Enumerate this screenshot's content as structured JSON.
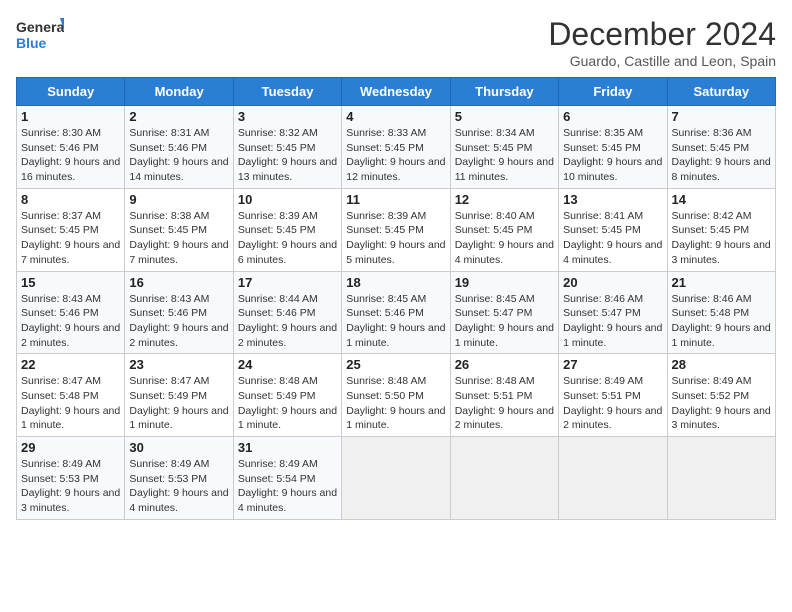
{
  "logo": {
    "line1": "General",
    "line2": "Blue"
  },
  "title": "December 2024",
  "location": "Guardo, Castille and Leon, Spain",
  "days_of_week": [
    "Sunday",
    "Monday",
    "Tuesday",
    "Wednesday",
    "Thursday",
    "Friday",
    "Saturday"
  ],
  "weeks": [
    [
      {
        "day": "1",
        "sunrise": "8:30 AM",
        "sunset": "5:46 PM",
        "daylight": "9 hours and 16 minutes."
      },
      {
        "day": "2",
        "sunrise": "8:31 AM",
        "sunset": "5:46 PM",
        "daylight": "9 hours and 14 minutes."
      },
      {
        "day": "3",
        "sunrise": "8:32 AM",
        "sunset": "5:45 PM",
        "daylight": "9 hours and 13 minutes."
      },
      {
        "day": "4",
        "sunrise": "8:33 AM",
        "sunset": "5:45 PM",
        "daylight": "9 hours and 12 minutes."
      },
      {
        "day": "5",
        "sunrise": "8:34 AM",
        "sunset": "5:45 PM",
        "daylight": "9 hours and 11 minutes."
      },
      {
        "day": "6",
        "sunrise": "8:35 AM",
        "sunset": "5:45 PM",
        "daylight": "9 hours and 10 minutes."
      },
      {
        "day": "7",
        "sunrise": "8:36 AM",
        "sunset": "5:45 PM",
        "daylight": "9 hours and 8 minutes."
      }
    ],
    [
      {
        "day": "8",
        "sunrise": "8:37 AM",
        "sunset": "5:45 PM",
        "daylight": "9 hours and 7 minutes."
      },
      {
        "day": "9",
        "sunrise": "8:38 AM",
        "sunset": "5:45 PM",
        "daylight": "9 hours and 7 minutes."
      },
      {
        "day": "10",
        "sunrise": "8:39 AM",
        "sunset": "5:45 PM",
        "daylight": "9 hours and 6 minutes."
      },
      {
        "day": "11",
        "sunrise": "8:39 AM",
        "sunset": "5:45 PM",
        "daylight": "9 hours and 5 minutes."
      },
      {
        "day": "12",
        "sunrise": "8:40 AM",
        "sunset": "5:45 PM",
        "daylight": "9 hours and 4 minutes."
      },
      {
        "day": "13",
        "sunrise": "8:41 AM",
        "sunset": "5:45 PM",
        "daylight": "9 hours and 4 minutes."
      },
      {
        "day": "14",
        "sunrise": "8:42 AM",
        "sunset": "5:45 PM",
        "daylight": "9 hours and 3 minutes."
      }
    ],
    [
      {
        "day": "15",
        "sunrise": "8:43 AM",
        "sunset": "5:46 PM",
        "daylight": "9 hours and 2 minutes."
      },
      {
        "day": "16",
        "sunrise": "8:43 AM",
        "sunset": "5:46 PM",
        "daylight": "9 hours and 2 minutes."
      },
      {
        "day": "17",
        "sunrise": "8:44 AM",
        "sunset": "5:46 PM",
        "daylight": "9 hours and 2 minutes."
      },
      {
        "day": "18",
        "sunrise": "8:45 AM",
        "sunset": "5:46 PM",
        "daylight": "9 hours and 1 minute."
      },
      {
        "day": "19",
        "sunrise": "8:45 AM",
        "sunset": "5:47 PM",
        "daylight": "9 hours and 1 minute."
      },
      {
        "day": "20",
        "sunrise": "8:46 AM",
        "sunset": "5:47 PM",
        "daylight": "9 hours and 1 minute."
      },
      {
        "day": "21",
        "sunrise": "8:46 AM",
        "sunset": "5:48 PM",
        "daylight": "9 hours and 1 minute."
      }
    ],
    [
      {
        "day": "22",
        "sunrise": "8:47 AM",
        "sunset": "5:48 PM",
        "daylight": "9 hours and 1 minute."
      },
      {
        "day": "23",
        "sunrise": "8:47 AM",
        "sunset": "5:49 PM",
        "daylight": "9 hours and 1 minute."
      },
      {
        "day": "24",
        "sunrise": "8:48 AM",
        "sunset": "5:49 PM",
        "daylight": "9 hours and 1 minute."
      },
      {
        "day": "25",
        "sunrise": "8:48 AM",
        "sunset": "5:50 PM",
        "daylight": "9 hours and 1 minute."
      },
      {
        "day": "26",
        "sunrise": "8:48 AM",
        "sunset": "5:51 PM",
        "daylight": "9 hours and 2 minutes."
      },
      {
        "day": "27",
        "sunrise": "8:49 AM",
        "sunset": "5:51 PM",
        "daylight": "9 hours and 2 minutes."
      },
      {
        "day": "28",
        "sunrise": "8:49 AM",
        "sunset": "5:52 PM",
        "daylight": "9 hours and 3 minutes."
      }
    ],
    [
      {
        "day": "29",
        "sunrise": "8:49 AM",
        "sunset": "5:53 PM",
        "daylight": "9 hours and 3 minutes."
      },
      {
        "day": "30",
        "sunrise": "8:49 AM",
        "sunset": "5:53 PM",
        "daylight": "9 hours and 4 minutes."
      },
      {
        "day": "31",
        "sunrise": "8:49 AM",
        "sunset": "5:54 PM",
        "daylight": "9 hours and 4 minutes."
      },
      null,
      null,
      null,
      null
    ]
  ],
  "labels": {
    "sunrise": "Sunrise:",
    "sunset": "Sunset:",
    "daylight": "Daylight:"
  }
}
